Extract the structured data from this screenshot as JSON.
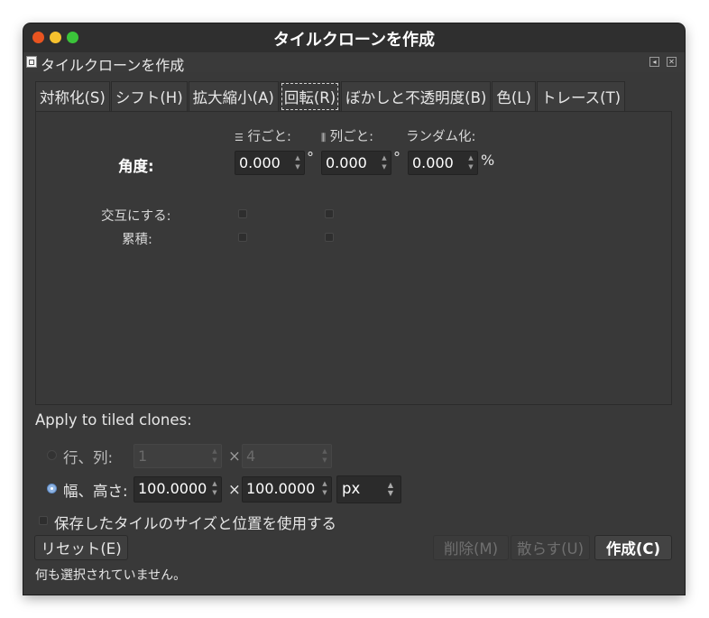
{
  "window": {
    "title": "タイルクローンを作成",
    "dock_title": "タイルクローンを作成",
    "colors": {
      "close": "#e95420",
      "minimize": "#f6c12e",
      "maximize": "#3bc43a",
      "background": "#393939"
    }
  },
  "tabs": [
    {
      "label": "対称化(S)",
      "active": false
    },
    {
      "label": "シフト(H)",
      "active": false
    },
    {
      "label": "拡大縮小(A)",
      "active": false
    },
    {
      "label": "回転(R)",
      "active": true
    },
    {
      "label": "ぼかしと不透明度(B)",
      "active": false
    },
    {
      "label": "色(L)",
      "active": false
    },
    {
      "label": "トレース(T)",
      "active": false
    }
  ],
  "rotation": {
    "col_rows": "行ごと:",
    "col_cols": "列ごと:",
    "col_random": "ランダム化:",
    "angle_label": "角度:",
    "angle_rows": "0.000",
    "angle_cols": "0.000",
    "angle_random": "0.000",
    "unit_deg": "°",
    "unit_pct": "%",
    "alternate_label": "交互にする:",
    "cumulate_label": "累積:"
  },
  "apply": {
    "heading": "Apply to tiled clones:",
    "rows_cols_label": "行、列:",
    "rows_value": "1",
    "cols_value": "4",
    "times": "×",
    "width_height_label": "幅、高さ:",
    "width_value": "100.0000",
    "height_value": "100.0000",
    "unit": "px",
    "use_saved_label": "保存したタイルのサイズと位置を使用する"
  },
  "buttons": {
    "reset": "リセット(E)",
    "remove": "削除(M)",
    "unclump": "散らす(U)",
    "create": "作成(C)"
  },
  "status": "何も選択されていません。"
}
